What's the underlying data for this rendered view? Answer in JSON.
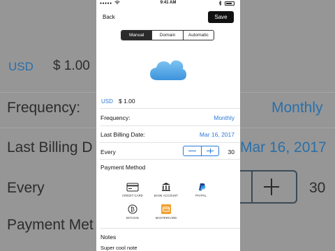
{
  "background": {
    "currency_code": "USD",
    "amount": "$ 1.00",
    "frequency_label": "Frequency:",
    "frequency_value": "Monthly",
    "last_billing_label": "Last Billing D",
    "last_billing_value": "Mar 16, 2017",
    "every_label": "Every",
    "every_value": "30",
    "payment_label": "Payment Met"
  },
  "status_bar": {
    "signal": "●●●●●",
    "time": "9:41 AM"
  },
  "nav": {
    "back_label": "Back",
    "save_label": "Save"
  },
  "tabs": [
    {
      "label": "Manual",
      "active": true
    },
    {
      "label": "Domain",
      "active": false
    },
    {
      "label": "Automatic",
      "active": false
    }
  ],
  "icon": "cloud-icon",
  "price": {
    "currency_code": "USD",
    "amount": "$ 1.00"
  },
  "form": {
    "frequency_label": "Frequency:",
    "frequency_value": "Monthly",
    "last_billing_label": "Last Billing Date:",
    "last_billing_value": "Mar 16, 2017",
    "every_label": "Every",
    "every_value": "30"
  },
  "payment": {
    "title": "Payment Method",
    "methods": [
      {
        "label": "CREDIT CARD",
        "icon": "credit-card-icon"
      },
      {
        "label": "BANK ACCOUNT",
        "icon": "bank-icon"
      },
      {
        "label": "PAYPAL",
        "icon": "paypal-icon"
      },
      {
        "label": "BITCOIN",
        "icon": "bitcoin-icon"
      },
      {
        "label": "MASTERCARD",
        "icon": "mastercard-icon"
      }
    ]
  },
  "notes": {
    "label": "Notes",
    "text": "Super cool note"
  },
  "colors": {
    "accent": "#2a7ad6",
    "save_bg": "#111111",
    "active_tab_bg": "#2a2a2a",
    "mastercard": "#f0a030"
  }
}
